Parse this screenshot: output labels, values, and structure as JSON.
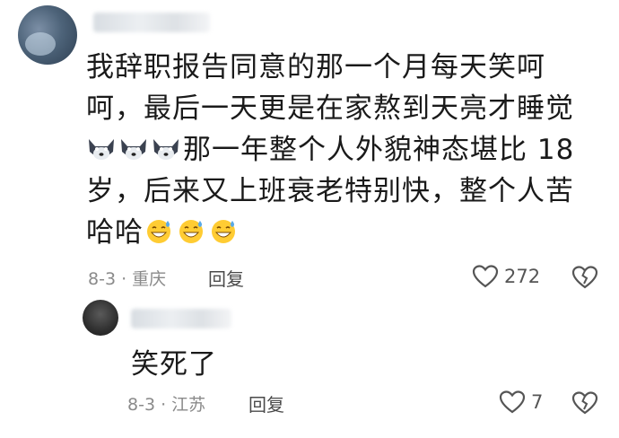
{
  "comment": {
    "text_lines": [
      "我辞职报告同意的那一个月每天笑呵",
      "呵，最后一天更是在家熬到天亮才睡觉",
      "那一年整个人外貌神态堪比 18",
      "岁，后来又上班衰老特别快，整个人苦",
      "哈哈"
    ],
    "line3_emoji": "dog-face-icon",
    "line5_emoji": "grinning-sweat-icon",
    "date_location": "8-3 · 重庆",
    "reply_label": "回复",
    "like_count": "272"
  },
  "reply": {
    "text": "笑死了",
    "date_location": "8-3 · 江苏",
    "reply_label": "回复",
    "like_count": "7"
  },
  "colors": {
    "text": "#1a1a1a",
    "meta": "#8a8a8a",
    "icon": "#555555"
  }
}
